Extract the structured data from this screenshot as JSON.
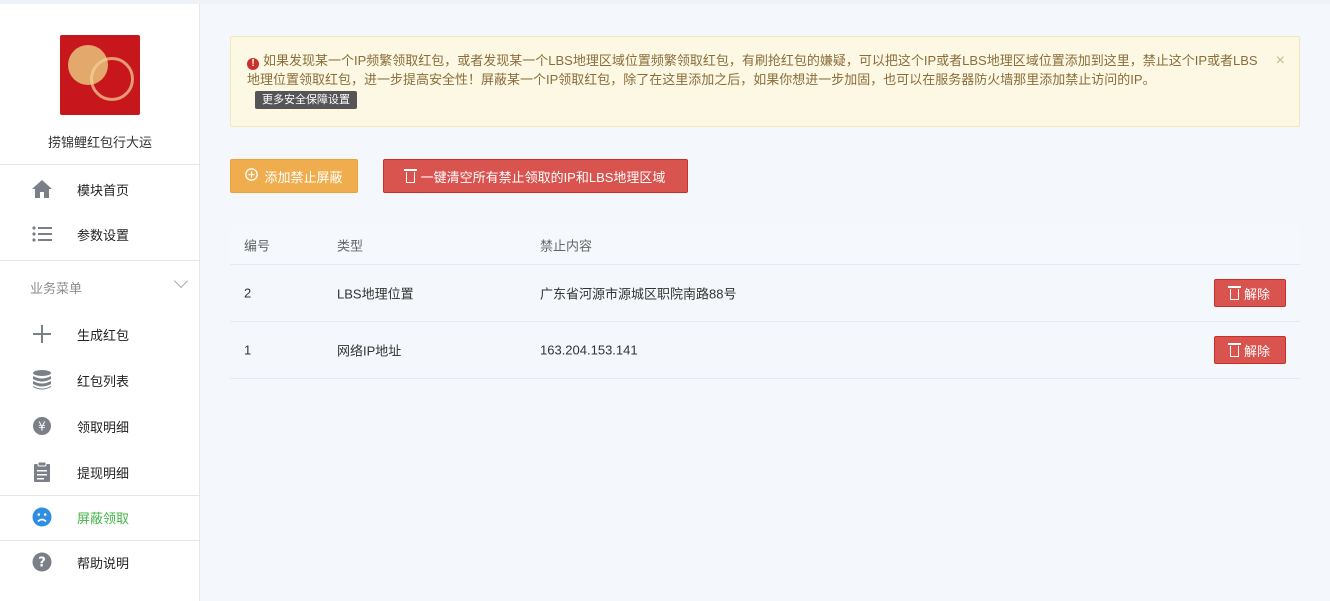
{
  "sidebar": {
    "app_name": "捞锦鲤红包行大运",
    "items_top": [
      {
        "label": "模块首页",
        "icon": "home-icon"
      },
      {
        "label": "参数设置",
        "icon": "list-settings-icon"
      }
    ],
    "section_title": "业务菜单",
    "items": [
      {
        "label": "生成红包",
        "icon": "plus-icon"
      },
      {
        "label": "红包列表",
        "icon": "database-icon"
      },
      {
        "label": "领取明细",
        "icon": "yen-coin-icon"
      },
      {
        "label": "提现明细",
        "icon": "clipboard-icon"
      },
      {
        "label": "屏蔽领取",
        "icon": "sad-face-icon",
        "active": true
      },
      {
        "label": "帮助说明",
        "icon": "question-icon"
      }
    ],
    "active_color": "#44b549"
  },
  "alert": {
    "text": "如果发现某一个IP频繁领取红包，或者发现某一个LBS地理区域位置频繁领取红包，有刷抢红包的嫌疑，可以把这个IP或者LBS地理区域位置添加到这里，禁止这个IP或者LBS地理位置领取红包，进一步提高安全性！屏蔽某一个IP领取红包，除了在这里添加之后，如果你想进一步加固，也可以在服务器防火墙那里添加禁止访问的IP。",
    "more_label": "更多安全保障设置",
    "close_label": "×"
  },
  "toolbar": {
    "add_label": "添加禁止屏蔽",
    "clear_label": "一键清空所有禁止领取的IP和LBS地理区域"
  },
  "table": {
    "headers": [
      "编号",
      "类型",
      "禁止内容"
    ],
    "rows": [
      {
        "id": "2",
        "type": "LBS地理位置",
        "content": "广东省河源市源城区职院南路88号",
        "action": "解除"
      },
      {
        "id": "1",
        "type": "网络IP地址",
        "content": "163.204.153.141",
        "action": "解除"
      }
    ]
  },
  "colors": {
    "orange": "#f0ad4e",
    "red": "#d9534f",
    "alert_bg": "#fcf8e3"
  }
}
